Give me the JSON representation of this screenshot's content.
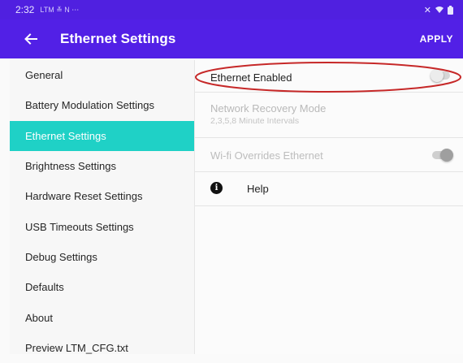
{
  "status_bar": {
    "time": "2:32",
    "minor": "LTM ≚ N ⋯",
    "right": "◂ ⚡"
  },
  "app_bar": {
    "title": "Ethernet Settings",
    "apply_label": "APPLY"
  },
  "sidebar": {
    "items": [
      {
        "label": "General",
        "active": false
      },
      {
        "label": "Battery Modulation Settings",
        "active": false
      },
      {
        "label": "Ethernet Settings",
        "active": true
      },
      {
        "label": "Brightness Settings",
        "active": false
      },
      {
        "label": "Hardware Reset Settings",
        "active": false
      },
      {
        "label": "USB Timeouts Settings",
        "active": false
      },
      {
        "label": "Debug Settings",
        "active": false
      },
      {
        "label": "Defaults",
        "active": false
      },
      {
        "label": "About",
        "active": false
      },
      {
        "label": "Preview LTM_CFG.txt",
        "active": false
      }
    ]
  },
  "settings": {
    "ethernet_enabled": {
      "label": "Ethernet Enabled",
      "enabled": false
    },
    "network_recovery": {
      "label": "Network Recovery Mode",
      "sub": "2,3,5,8 Minute Intervals"
    },
    "wifi_overrides": {
      "label": "Wi-fi Overrides Ethernet",
      "enabled": true
    },
    "help": {
      "label": "Help",
      "icon": "info-icon"
    }
  },
  "colors": {
    "app_bar": "#5220e6",
    "active_item": "#1fd1c6",
    "annotation_ellipse": "#c62828"
  }
}
